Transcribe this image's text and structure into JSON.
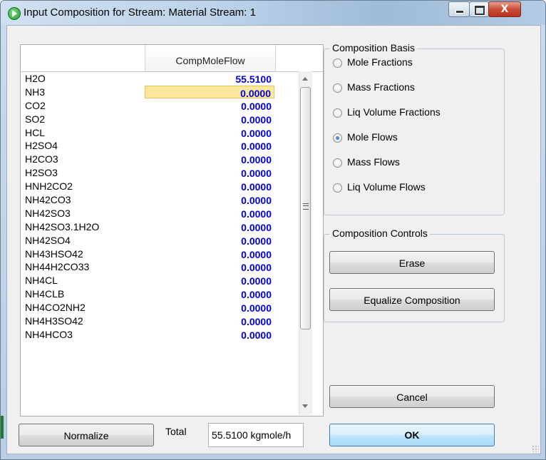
{
  "window": {
    "title": "Input Composition for Stream: Material Stream: 1",
    "close_glyph": "X",
    "minimize_icon": "minimize-icon",
    "maximize_icon": "maximize-icon",
    "app_icon": "play-icon"
  },
  "grid": {
    "column_header": "CompMoleFlow",
    "rows": [
      {
        "name": "H2O",
        "value": "55.5100"
      },
      {
        "name": "NH3",
        "value": "0.0000"
      },
      {
        "name": "CO2",
        "value": "0.0000"
      },
      {
        "name": "SO2",
        "value": "0.0000"
      },
      {
        "name": "HCL",
        "value": "0.0000"
      },
      {
        "name": "H2SO4",
        "value": "0.0000"
      },
      {
        "name": "H2CO3",
        "value": "0.0000"
      },
      {
        "name": "H2SO3",
        "value": "0.0000"
      },
      {
        "name": "HNH2CO2",
        "value": "0.0000"
      },
      {
        "name": "NH42CO3",
        "value": "0.0000"
      },
      {
        "name": "NH42SO3",
        "value": "0.0000"
      },
      {
        "name": "NH42SO3.1H2O",
        "value": "0.0000"
      },
      {
        "name": "NH42SO4",
        "value": "0.0000"
      },
      {
        "name": "NH43HSO42",
        "value": "0.0000"
      },
      {
        "name": "NH44H2CO33",
        "value": "0.0000"
      },
      {
        "name": "NH4CL",
        "value": "0.0000"
      },
      {
        "name": "NH4CLB",
        "value": "0.0000"
      },
      {
        "name": "NH4CO2NH2",
        "value": "0.0000"
      },
      {
        "name": "NH4H3SO42",
        "value": "0.0000"
      },
      {
        "name": "NH4HCO3",
        "value": "0.0000"
      }
    ],
    "selected_row_index": 1
  },
  "composition_basis": {
    "title": "Composition Basis",
    "options": [
      {
        "label": "Mole Fractions",
        "checked": false
      },
      {
        "label": "Mass Fractions",
        "checked": false
      },
      {
        "label": "Liq Volume Fractions",
        "checked": false
      },
      {
        "label": "Mole Flows",
        "checked": true
      },
      {
        "label": "Mass Flows",
        "checked": false
      },
      {
        "label": "Liq Volume Flows",
        "checked": false
      }
    ]
  },
  "composition_controls": {
    "title": "Composition Controls",
    "erase_label": "Erase",
    "equalize_label": "Equalize Composition"
  },
  "footer": {
    "normalize_label": "Normalize",
    "total_label": "Total",
    "total_value": "55.5100 kgmole/h",
    "cancel_label": "Cancel",
    "ok_label": "OK"
  }
}
